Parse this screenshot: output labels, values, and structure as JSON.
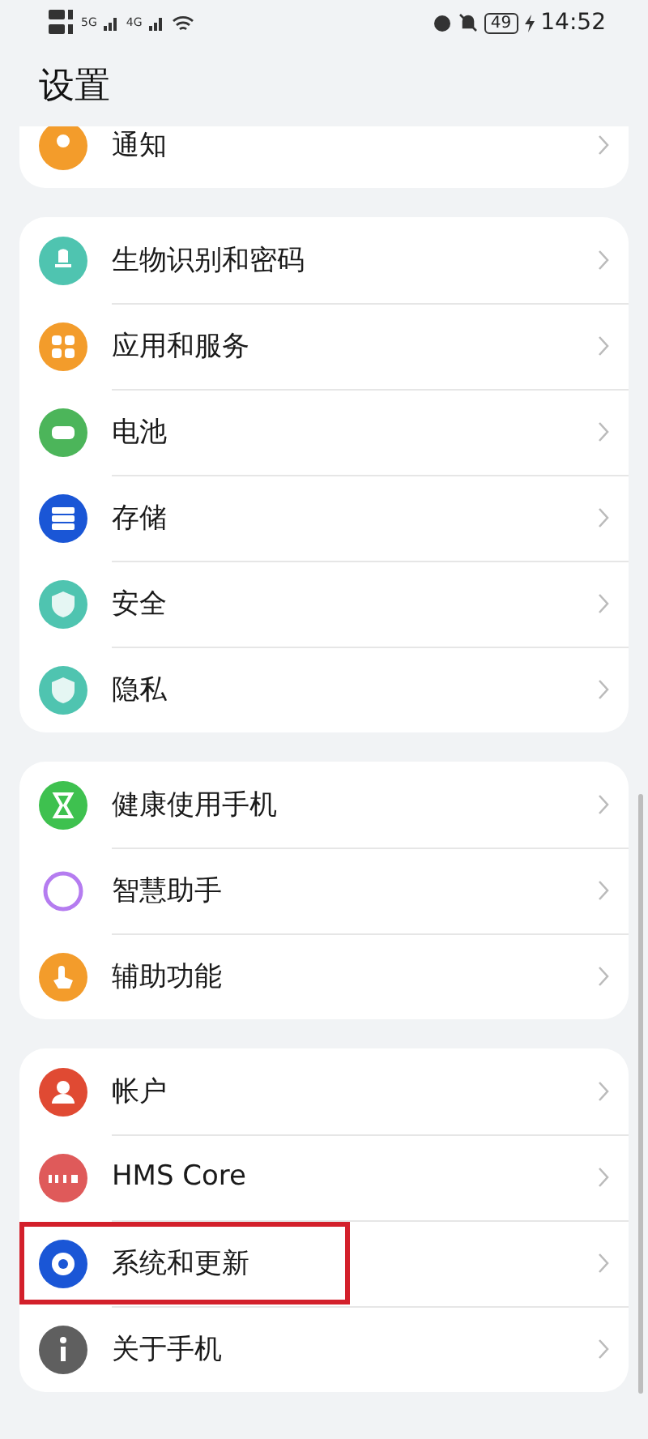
{
  "status_bar": {
    "network_1": "5G",
    "network_2": "4G",
    "battery": "49",
    "time": "14:52"
  },
  "title": "设置",
  "groups": [
    {
      "clipped": true,
      "items": [
        {
          "label": "通知",
          "color": "#f39c2b",
          "highlighted": false
        }
      ]
    },
    {
      "clipped": false,
      "items": [
        {
          "label": "生物识别和密码",
          "color": "#4fc4b0",
          "highlighted": false
        },
        {
          "label": "应用和服务",
          "color": "#f39c2b",
          "highlighted": false
        },
        {
          "label": "电池",
          "color": "#4cb55a",
          "highlighted": false
        },
        {
          "label": "存储",
          "color": "#1a56d6",
          "highlighted": false
        },
        {
          "label": "安全",
          "color": "#4fc4b0",
          "highlighted": false
        },
        {
          "label": "隐私",
          "color": "#4fc4b0",
          "highlighted": false
        }
      ]
    },
    {
      "clipped": false,
      "items": [
        {
          "label": "健康使用手机",
          "color": "#3ec14f",
          "highlighted": false
        },
        {
          "label": "智慧助手",
          "color": "#b57cf0",
          "highlighted": false
        },
        {
          "label": "辅助功能",
          "color": "#f39c2b",
          "highlighted": false
        }
      ]
    },
    {
      "clipped": false,
      "items": [
        {
          "label": "帐户",
          "color": "#e04a33",
          "highlighted": false
        },
        {
          "label": "HMS Core",
          "color": "#df5a5a",
          "highlighted": false
        },
        {
          "label": "系统和更新",
          "color": "#1a56d6",
          "highlighted": true
        },
        {
          "label": "关于手机",
          "color": "#5f5f5f",
          "highlighted": false
        }
      ]
    }
  ]
}
